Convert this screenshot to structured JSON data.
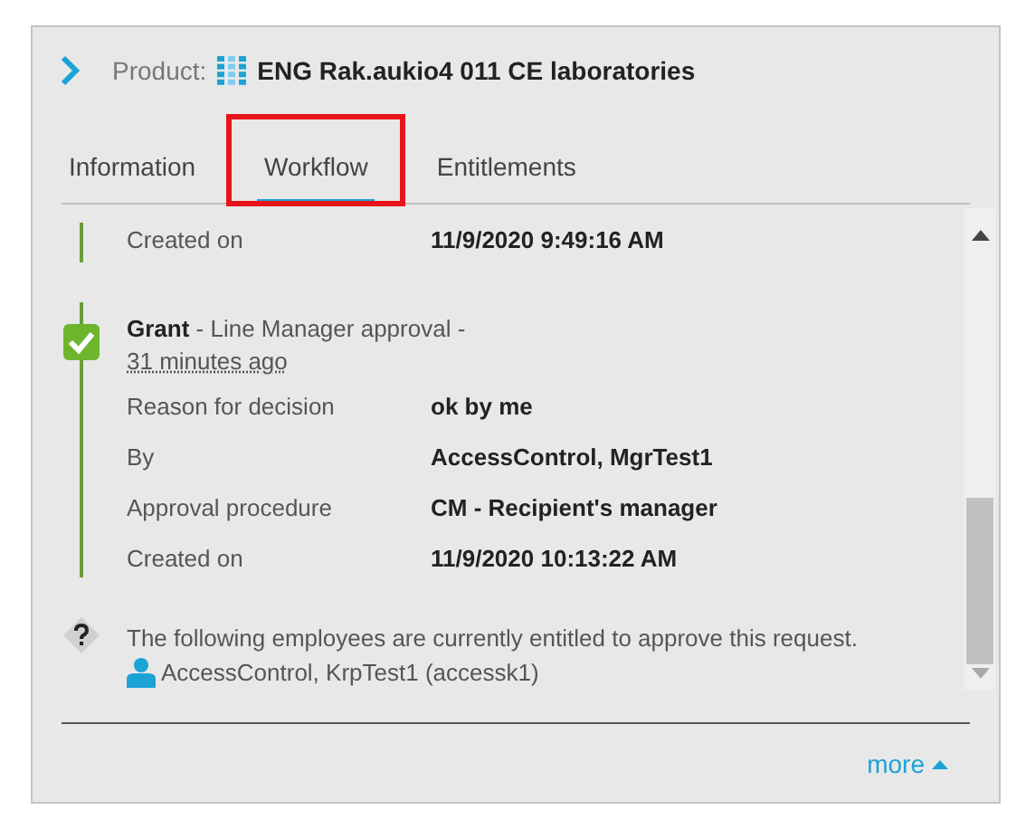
{
  "header": {
    "prefix": "Product:",
    "title": "ENG Rak.aukio4 011 CE laboratories"
  },
  "tabs": [
    {
      "label": "Information",
      "selected": false,
      "highlighted": false
    },
    {
      "label": "Workflow",
      "selected": true,
      "highlighted": true
    },
    {
      "label": "Entitlements",
      "selected": false,
      "highlighted": false
    }
  ],
  "events": [
    {
      "kind": "partial",
      "fields": [
        {
          "label": "Created on",
          "value": "11/9/2020 9:49:16 AM"
        }
      ]
    },
    {
      "kind": "approved",
      "decision": "Grant",
      "description": " - Line Manager approval -",
      "time": "31 minutes ago",
      "fields": [
        {
          "label": "Reason for decision",
          "value": "ok by me"
        },
        {
          "label": "By",
          "value": "AccessControl, MgrTest1"
        },
        {
          "label": "Approval procedure",
          "value": "CM - Recipient's manager"
        },
        {
          "label": "Created on",
          "value": "11/9/2020 10:13:22 AM"
        }
      ]
    }
  ],
  "info": {
    "text": "The following employees are currently entitled to approve this request.",
    "approver": "AccessControl, KrpTest1 (accessk1)"
  },
  "more_link": "more"
}
